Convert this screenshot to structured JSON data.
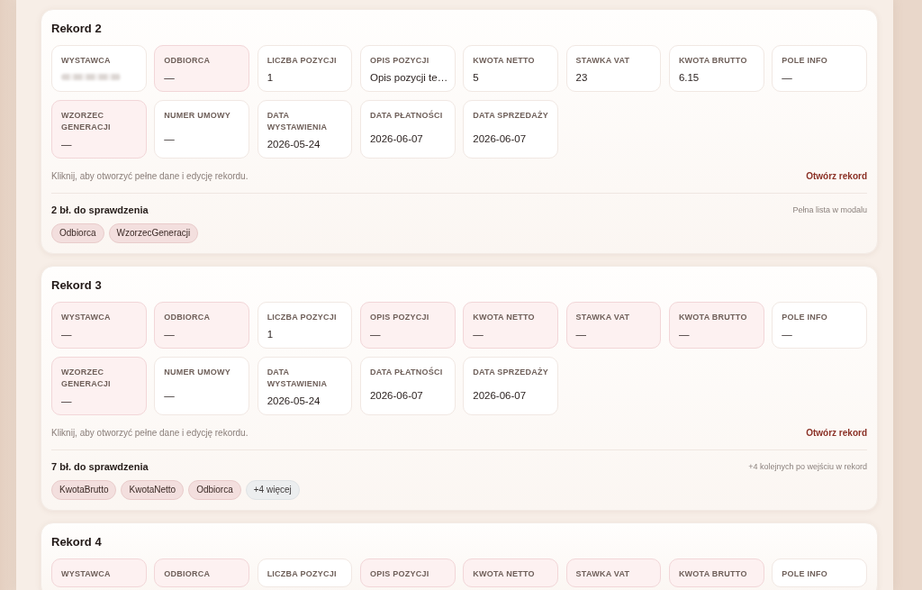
{
  "records": [
    {
      "title": "Rekord 2",
      "fields": [
        {
          "label": "WYSTAWCA",
          "redacted": true,
          "error": false
        },
        {
          "label": "ODBIORCA",
          "value": "—",
          "redacted": false,
          "error": true
        },
        {
          "label": "LICZBA POZYCJI",
          "value": "1",
          "redacted": false,
          "error": false
        },
        {
          "label": "OPIS POZYCJI",
          "value": "Opis pozycji te…",
          "redacted": false,
          "error": false
        },
        {
          "label": "KWOTA NETTO",
          "value": "5",
          "redacted": false,
          "error": false
        },
        {
          "label": "STAWKA VAT",
          "value": "23",
          "redacted": false,
          "error": false
        },
        {
          "label": "KWOTA BRUTTO",
          "value": "6.15",
          "redacted": false,
          "error": false
        },
        {
          "label": "POLE INFO",
          "value": "—",
          "redacted": false,
          "error": false
        },
        {
          "label": "WZORZEC GENERACJI",
          "value": "—",
          "redacted": false,
          "error": true
        },
        {
          "label": "NUMER UMOWY",
          "value": "—",
          "redacted": false,
          "error": false
        },
        {
          "label": "DATA WYSTAWIENIA",
          "value": "2026-05-24",
          "redacted": false,
          "error": false
        },
        {
          "label": "DATA PŁATNOŚCI",
          "value": "2026-06-07",
          "redacted": false,
          "error": false
        },
        {
          "label": "DATA SPRZEDAŻY",
          "value": "2026-06-07",
          "redacted": false,
          "error": false
        }
      ],
      "hint": "Kliknij, aby otworzyć pełne dane i edycję rekordu.",
      "open_link": "Otwórz rekord",
      "errors_heading": "2 bł. do sprawdzenia",
      "errors_note": "Pełna lista w modalu",
      "chips": [
        {
          "kind": "field",
          "label": "Odbiorca"
        },
        {
          "kind": "field",
          "label": "WzorzecGeneracji"
        }
      ]
    },
    {
      "title": "Rekord 3",
      "fields": [
        {
          "label": "WYSTAWCA",
          "value": "—",
          "redacted": false,
          "error": true
        },
        {
          "label": "ODBIORCA",
          "value": "—",
          "redacted": false,
          "error": true
        },
        {
          "label": "LICZBA POZYCJI",
          "value": "1",
          "redacted": false,
          "error": false
        },
        {
          "label": "OPIS POZYCJI",
          "value": "—",
          "redacted": false,
          "error": true
        },
        {
          "label": "KWOTA NETTO",
          "value": "—",
          "redacted": false,
          "error": true
        },
        {
          "label": "STAWKA VAT",
          "value": "—",
          "redacted": false,
          "error": true
        },
        {
          "label": "KWOTA BRUTTO",
          "value": "—",
          "redacted": false,
          "error": true
        },
        {
          "label": "POLE INFO",
          "value": "—",
          "redacted": false,
          "error": false
        },
        {
          "label": "WZORZEC GENERACJI",
          "value": "—",
          "redacted": false,
          "error": true
        },
        {
          "label": "NUMER UMOWY",
          "value": "—",
          "redacted": false,
          "error": false
        },
        {
          "label": "DATA WYSTAWIENIA",
          "value": "2026-05-24",
          "redacted": false,
          "error": false
        },
        {
          "label": "DATA PŁATNOŚCI",
          "value": "2026-06-07",
          "redacted": false,
          "error": false
        },
        {
          "label": "DATA SPRZEDAŻY",
          "value": "2026-06-07",
          "redacted": false,
          "error": false
        }
      ],
      "hint": "Kliknij, aby otworzyć pełne dane i edycję rekordu.",
      "open_link": "Otwórz rekord",
      "errors_heading": "7 bł. do sprawdzenia",
      "errors_note": "+4 kolejnych po wejściu w rekord",
      "chips": [
        {
          "kind": "field",
          "label": "KwotaBrutto"
        },
        {
          "kind": "field",
          "label": "KwotaNetto"
        },
        {
          "kind": "field",
          "label": "Odbiorca"
        },
        {
          "kind": "more",
          "label": "+4 więcej"
        }
      ]
    },
    {
      "title": "Rekord 4",
      "fields": [
        {
          "label": "WYSTAWCA",
          "error": true
        },
        {
          "label": "ODBIORCA",
          "error": true
        },
        {
          "label": "LICZBA POZYCJI",
          "error": false
        },
        {
          "label": "OPIS POZYCJI",
          "error": true
        },
        {
          "label": "KWOTA NETTO",
          "error": true
        },
        {
          "label": "STAWKA VAT",
          "error": true
        },
        {
          "label": "KWOTA BRUTTO",
          "error": true
        },
        {
          "label": "POLE INFO",
          "error": false
        }
      ]
    }
  ]
}
